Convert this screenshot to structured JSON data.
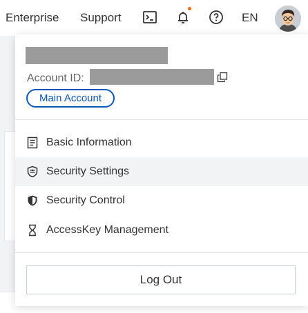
{
  "topbar": {
    "enterprise_label": "Enterprise",
    "support_label": "Support",
    "language_label": "EN",
    "notification_dot_color": "#ff6a00",
    "icons": [
      "terminal-icon",
      "bell-icon",
      "help-icon",
      "avatar"
    ]
  },
  "account": {
    "id_label": "Account ID:",
    "badge_label": "Main Account"
  },
  "menu": {
    "items": [
      {
        "label": "Basic Information",
        "icon": "document-icon"
      },
      {
        "label": "Security Settings",
        "icon": "shield-settings-icon",
        "active": true
      },
      {
        "label": "Security Control",
        "icon": "shield-icon"
      },
      {
        "label": "AccessKey Management",
        "icon": "key-icon"
      }
    ]
  },
  "logout_label": "Log Out",
  "colors": {
    "accent_blue": "#0a56b8",
    "active_row_bg": "#f2f3f5",
    "mask_gray": "#9b9b9b"
  }
}
